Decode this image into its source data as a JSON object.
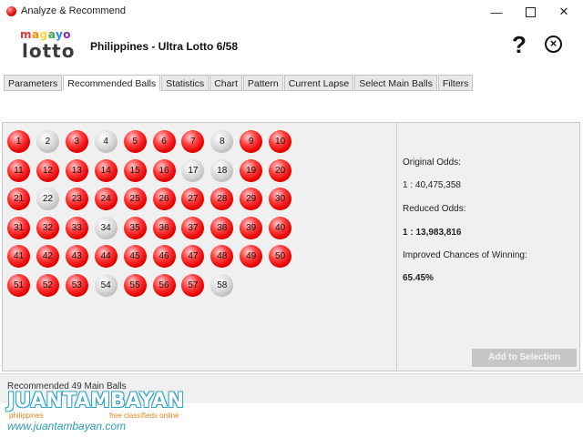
{
  "window": {
    "title": "Analyze & Recommend"
  },
  "header": {
    "logo_top": "magayo",
    "logo_bottom": "lotto",
    "heading": "Philippines - Ultra Lotto 6/58",
    "help_label": "?",
    "close_label": "×"
  },
  "tabs": [
    {
      "label": "Parameters"
    },
    {
      "label": "Recommended Balls",
      "active": true
    },
    {
      "label": "Statistics"
    },
    {
      "label": "Chart"
    },
    {
      "label": "Pattern"
    },
    {
      "label": "Current Lapse"
    },
    {
      "label": "Select Main Balls"
    },
    {
      "label": "Filters"
    }
  ],
  "balls": [
    {
      "n": "1",
      "s": "red"
    },
    {
      "n": "2",
      "s": "grey"
    },
    {
      "n": "3",
      "s": "red"
    },
    {
      "n": "4",
      "s": "grey"
    },
    {
      "n": "5",
      "s": "red"
    },
    {
      "n": "6",
      "s": "red"
    },
    {
      "n": "7",
      "s": "red"
    },
    {
      "n": "8",
      "s": "grey"
    },
    {
      "n": "9",
      "s": "red"
    },
    {
      "n": "10",
      "s": "red"
    },
    {
      "n": "11",
      "s": "red"
    },
    {
      "n": "12",
      "s": "red"
    },
    {
      "n": "13",
      "s": "red"
    },
    {
      "n": "14",
      "s": "red"
    },
    {
      "n": "15",
      "s": "red"
    },
    {
      "n": "16",
      "s": "red"
    },
    {
      "n": "17",
      "s": "grey"
    },
    {
      "n": "18",
      "s": "grey"
    },
    {
      "n": "19",
      "s": "red"
    },
    {
      "n": "20",
      "s": "red"
    },
    {
      "n": "21",
      "s": "red"
    },
    {
      "n": "22",
      "s": "grey"
    },
    {
      "n": "23",
      "s": "red"
    },
    {
      "n": "24",
      "s": "red"
    },
    {
      "n": "25",
      "s": "red"
    },
    {
      "n": "26",
      "s": "red"
    },
    {
      "n": "27",
      "s": "red"
    },
    {
      "n": "28",
      "s": "red"
    },
    {
      "n": "29",
      "s": "red"
    },
    {
      "n": "30",
      "s": "red"
    },
    {
      "n": "31",
      "s": "red"
    },
    {
      "n": "32",
      "s": "red"
    },
    {
      "n": "33",
      "s": "red"
    },
    {
      "n": "34",
      "s": "grey"
    },
    {
      "n": "35",
      "s": "red"
    },
    {
      "n": "36",
      "s": "red"
    },
    {
      "n": "37",
      "s": "red"
    },
    {
      "n": "38",
      "s": "red"
    },
    {
      "n": "39",
      "s": "red"
    },
    {
      "n": "40",
      "s": "red"
    },
    {
      "n": "41",
      "s": "red"
    },
    {
      "n": "42",
      "s": "red"
    },
    {
      "n": "43",
      "s": "red"
    },
    {
      "n": "44",
      "s": "red"
    },
    {
      "n": "45",
      "s": "red"
    },
    {
      "n": "46",
      "s": "red"
    },
    {
      "n": "47",
      "s": "red"
    },
    {
      "n": "48",
      "s": "red"
    },
    {
      "n": "49",
      "s": "red"
    },
    {
      "n": "50",
      "s": "red"
    },
    {
      "n": "51",
      "s": "red"
    },
    {
      "n": "52",
      "s": "red"
    },
    {
      "n": "53",
      "s": "red"
    },
    {
      "n": "54",
      "s": "grey"
    },
    {
      "n": "55",
      "s": "red"
    },
    {
      "n": "56",
      "s": "red"
    },
    {
      "n": "57",
      "s": "red"
    },
    {
      "n": "58",
      "s": "grey"
    }
  ],
  "odds": {
    "original_label": "Original Odds:",
    "original_value": "1 : 40,475,358",
    "reduced_label": "Reduced Odds:",
    "reduced_value": "1 : 13,983,816",
    "improved_label": "Improved Chances of Winning:",
    "improved_value": "65.45%"
  },
  "add_button_label": "Add to Selection",
  "status": "Recommended 49 Main Balls",
  "watermark": {
    "brand": "JUANTAMBAYAN",
    "sub_left": "philippines",
    "sub_right": "free classifieds online",
    "url": "www.juantambayan.com"
  },
  "colors": {
    "ball_selected": "#e40000",
    "ball_unselected": "#c0c0c0",
    "watermark_blue": "#2e9ab8",
    "watermark_orange": "#e0871a"
  }
}
